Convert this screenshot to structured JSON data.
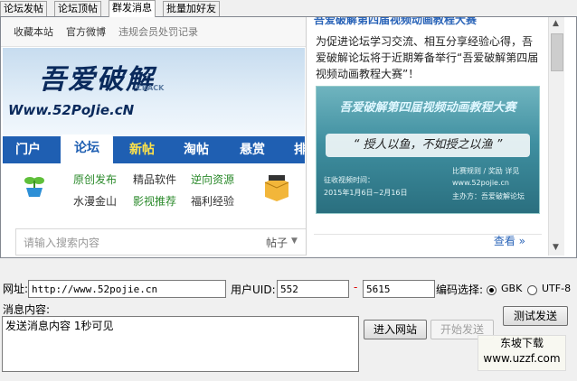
{
  "tabs": [
    "论坛发帖",
    "论坛顶帖",
    "群发消息",
    "批量加好友"
  ],
  "browser": {
    "topbar": [
      "收藏本站",
      "官方微博",
      "违规会员处罚记录"
    ],
    "logo": {
      "main": "吾爱破解",
      "crack": "CRACK",
      "url": "Www.52PoJie.cN"
    },
    "nav": [
      "门户",
      "论坛",
      "新帖",
      "淘帖",
      "悬赏",
      "排"
    ],
    "sublinks": [
      "原创发布",
      "精品软件",
      "逆向资源",
      "水漫金山",
      "影视推荐",
      "福利经验"
    ],
    "search": {
      "placeholder": "请输入搜索内容",
      "scope": "帖子"
    },
    "panel": {
      "title": "吾爱破解第四届视频动画教程大赛",
      "text": "为促进论坛学习交流、相互分享经验心得，吾爱破解论坛将于近期筹备举行“吾爱破解第四届视频动画教程大赛”！",
      "poster_title": "吾爱破解第四届视频动画教程大赛",
      "poster_quote": "“ 授人以鱼，不如授之以渔 ”",
      "poster_lines": [
        "征收视频时间：",
        "2015年1月6日~2月16日",
        "比赛规则 / 奖励 详见",
        "www.52pojie.cn",
        "主办方：吾爱破解论坛"
      ],
      "link": "查看 »"
    }
  },
  "form": {
    "url_label": "网址:",
    "url_value": "http://www.52pojie.cn",
    "uid_label": "用户UID:",
    "uid_from": "552",
    "uid_sep": "-",
    "uid_to": "5615",
    "encoding_label": "编码选择:",
    "enc_gbk": "GBK",
    "enc_utf8": "UTF-8",
    "msg_label": "消息内容:",
    "msg_value": "发送消息内容  1秒可见",
    "test_send": "测试发送",
    "enter_site": "进入网站",
    "start_send": "开始发送"
  },
  "watermark": {
    "line1": "东坡下载",
    "line2": "www.uzzf.com"
  }
}
